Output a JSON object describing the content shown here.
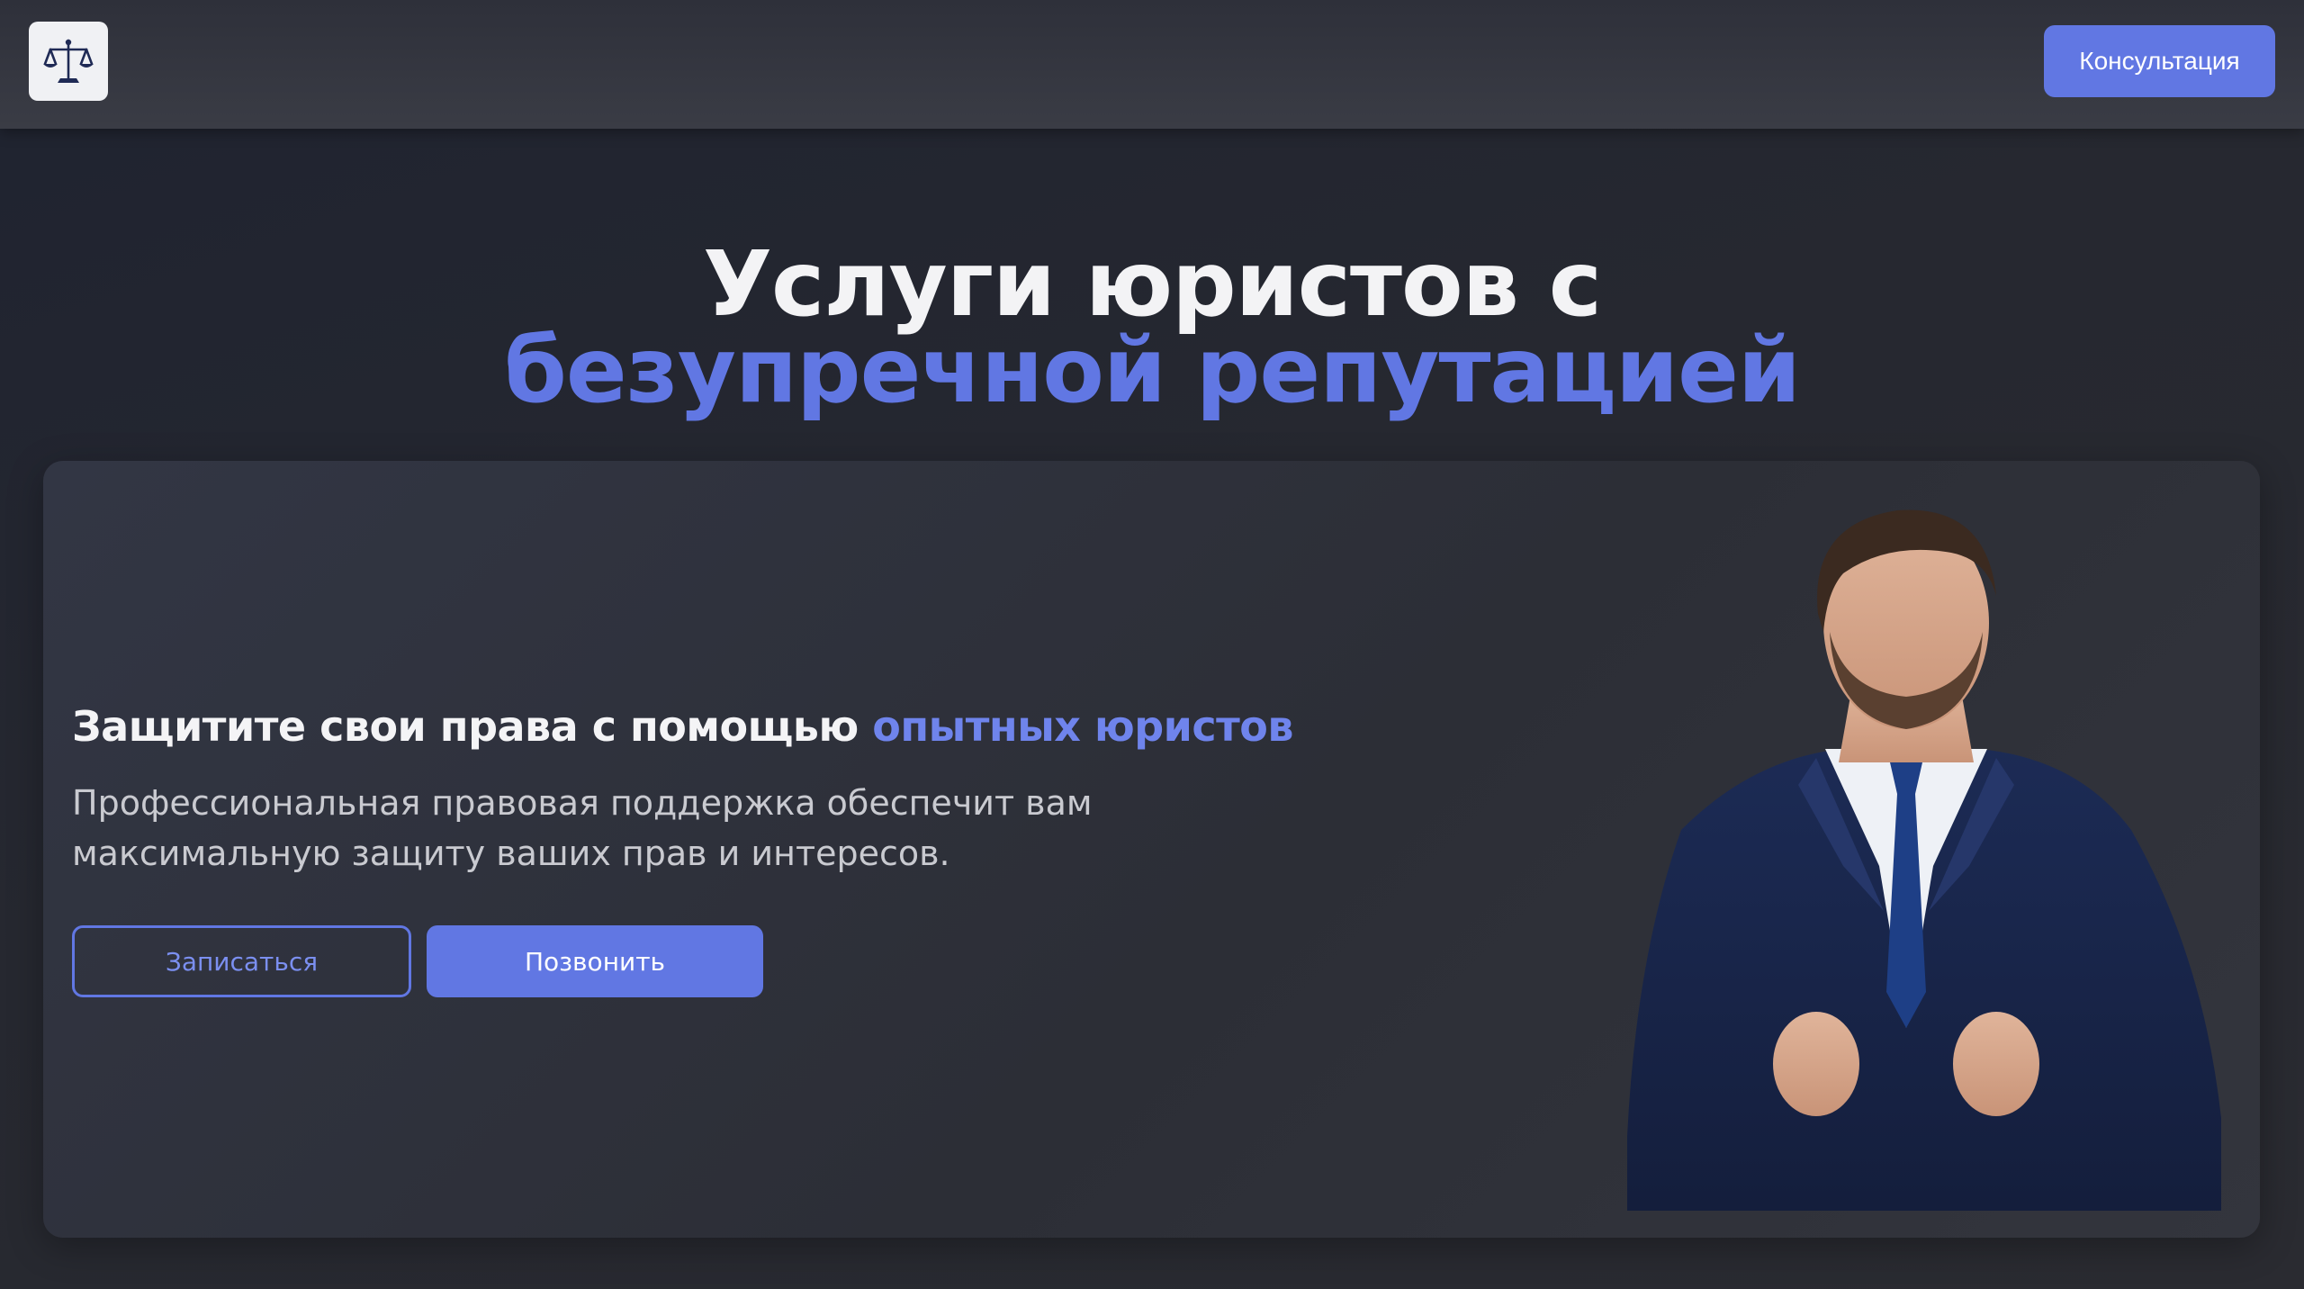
{
  "header": {
    "logo_icon": "scales-of-justice-icon",
    "cta_label": "Консультация"
  },
  "hero": {
    "title_line1": "Услуги юристов с",
    "title_line2": "безупречной репутацией"
  },
  "card": {
    "heading_main": "Защитите свои права с помощью ",
    "heading_accent": "опытных юристов",
    "text_line1": "Профессиональная правовая поддержка обеспечит вам",
    "text_line2": "максимальную защиту ваших прав и интересов.",
    "button_outline": "Записаться",
    "button_filled": "Позвонить",
    "photo_icon": "lawyer-portrait"
  },
  "colors": {
    "accent": "#6177e3",
    "background": "#23262f",
    "card": "#2f323b",
    "header": "#34363f"
  }
}
